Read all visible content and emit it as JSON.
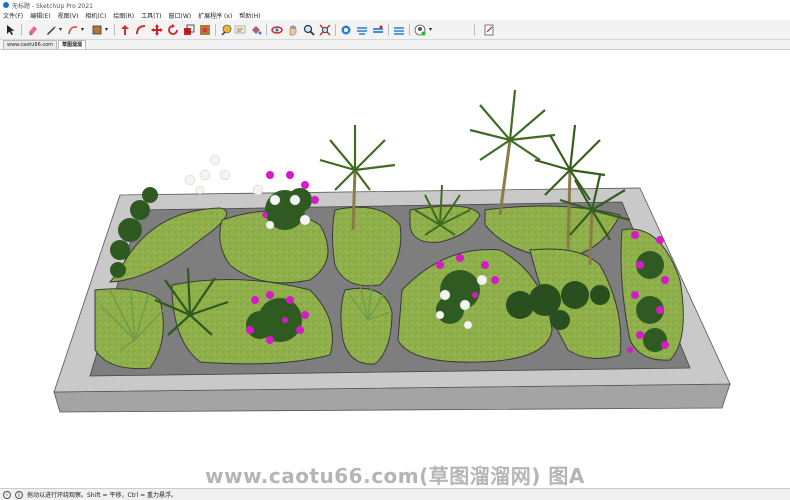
{
  "window": {
    "title": "无标题 - SketchUp Pro 2021"
  },
  "menu": [
    "文件(F)",
    "编辑(E)",
    "视图(V)",
    "相机(C)",
    "绘图(R)",
    "工具(T)",
    "窗口(W)",
    "扩展程序 (x)",
    "帮助(H)"
  ],
  "toolbar": {
    "icons": [
      "select-icon",
      "eraser-icon",
      "pencil-icon",
      "dropdown-arrow-icon",
      "arc-icon",
      "dropdown-arrow-icon",
      "rectangle-icon",
      "dropdown-arrow-icon",
      "push-pull-icon",
      "follow-me-icon",
      "move-icon",
      "rotate-icon",
      "scale-icon",
      "tape-measure-icon",
      "paint-bucket-icon",
      "text-icon",
      "orbit-icon",
      "pan-icon",
      "zoom-icon",
      "zoom-extents-icon",
      "warehouse-icon",
      "extension-warehouse-icon",
      "layout-icon",
      "share-icon",
      "user-icon",
      "dropdown-arrow-icon",
      "outliner-icon"
    ]
  },
  "tabs": [
    {
      "label": "www.caotu66.com"
    },
    {
      "label": "草图溜溜"
    }
  ],
  "watermark": "www.caotu66.com(草图溜溜网) 图A",
  "status": {
    "text": "拖动以进行环绕观察。Shift = 平移，Ctrl = 重力悬浮。"
  },
  "colors": {
    "grass": "#8fb04a",
    "paving": "#7e7e7e",
    "border": "#c9c9c9",
    "flower_magenta": "#d31cc6"
  }
}
